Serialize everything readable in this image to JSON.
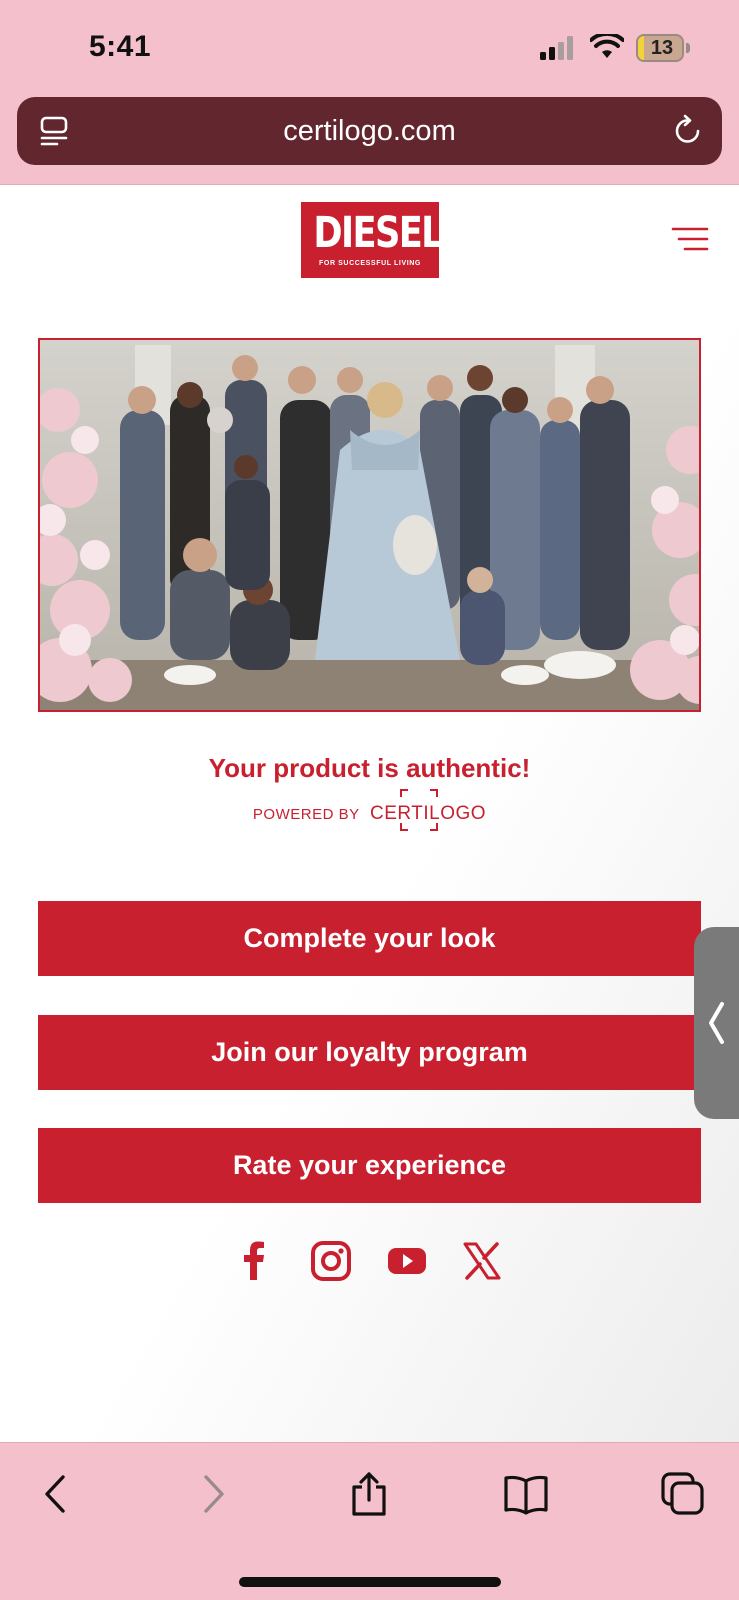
{
  "status_bar": {
    "time": "5:41",
    "battery_level": "13",
    "battery_fraction": 0.13
  },
  "browser": {
    "url": "certilogo.com"
  },
  "header": {
    "logo_text": "DIESEL",
    "logo_tagline": "FOR SUCCESSFUL LIVING",
    "menu_icon": "hamburger-menu-icon"
  },
  "main": {
    "hero_alt": "group-campaign-photo",
    "auth_message": "Your product is authentic!",
    "powered_by": "POWERED BY",
    "powered_brand": "CERTILOGO",
    "buttons": [
      {
        "label": "Complete your look"
      },
      {
        "label": "Join our loyalty program"
      },
      {
        "label": "Rate your experience"
      }
    ],
    "social": [
      "facebook-icon",
      "instagram-icon",
      "youtube-icon",
      "x-icon"
    ]
  },
  "colors": {
    "brand_red": "#c8202f",
    "chrome_pink": "#f3c0cb",
    "url_bar": "#62262f"
  }
}
